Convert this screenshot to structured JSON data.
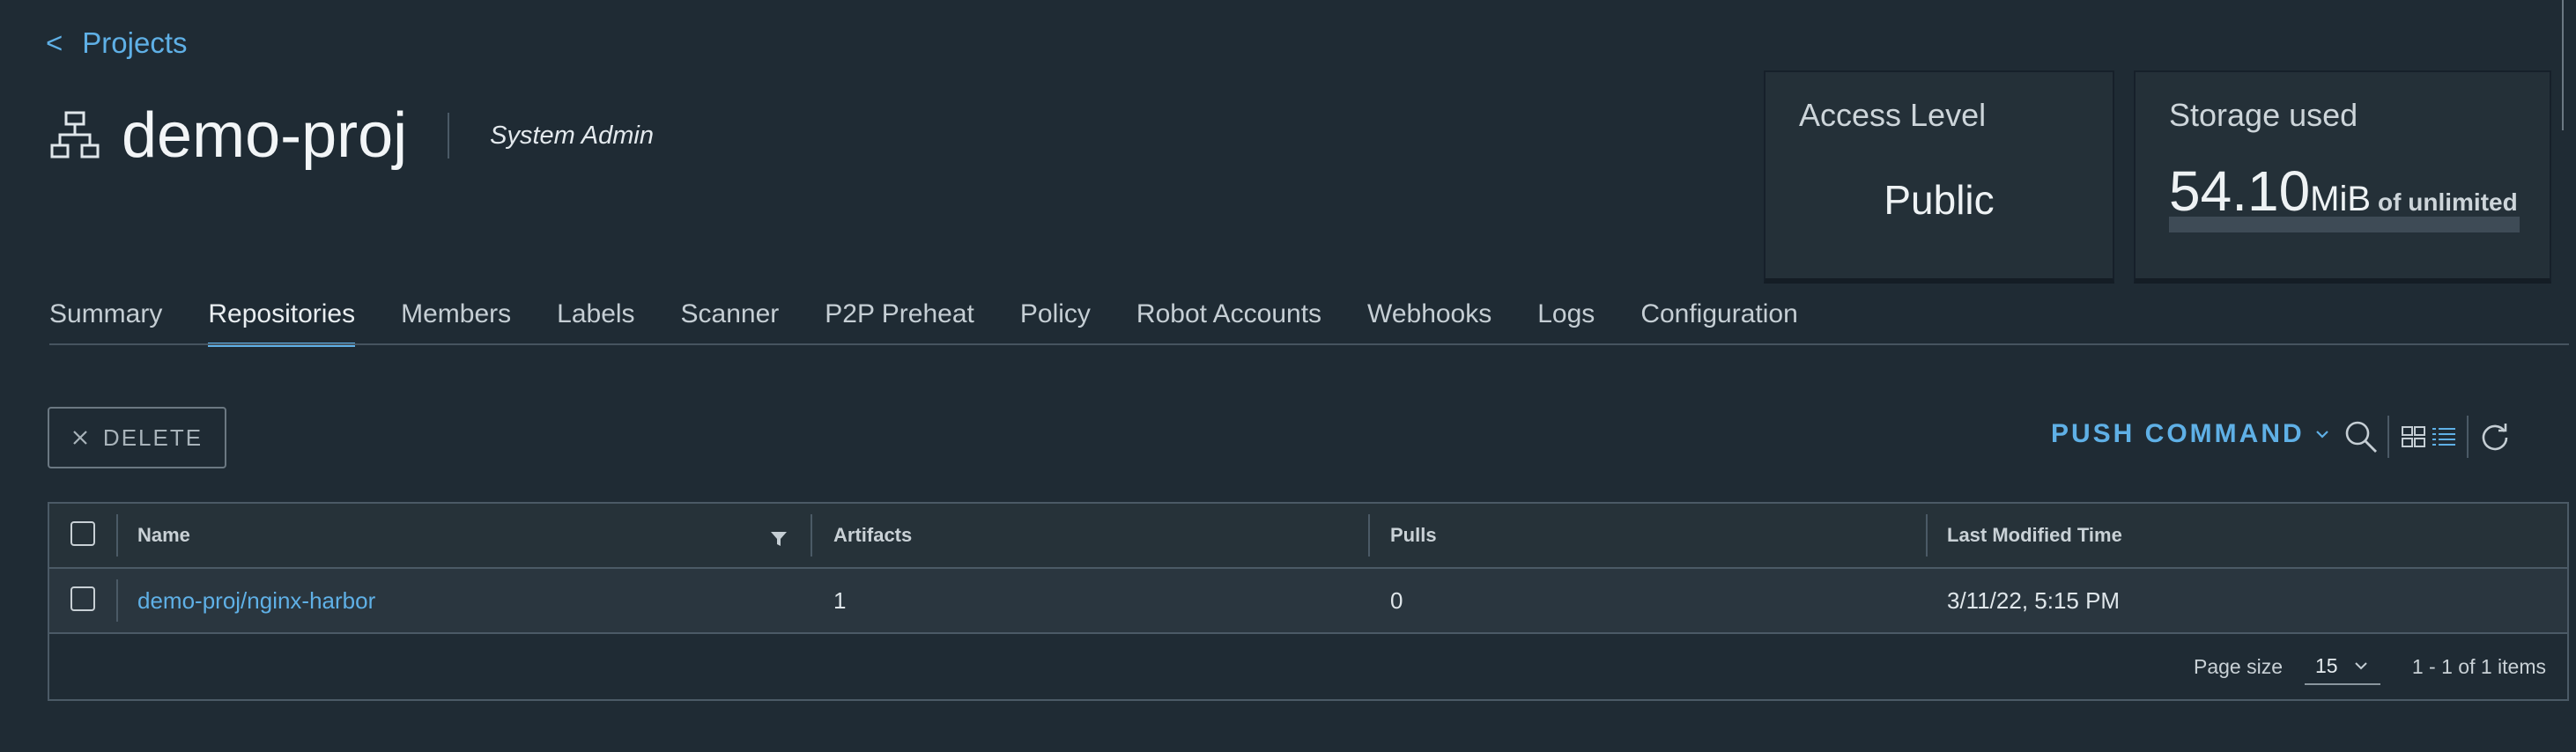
{
  "breadcrumb": {
    "chevron": "<",
    "label": "Projects"
  },
  "project": {
    "name": "demo-proj",
    "role": "System Admin",
    "icon": "project-hierarchy-icon"
  },
  "access_card": {
    "label": "Access Level",
    "value": "Public"
  },
  "storage_card": {
    "label": "Storage used",
    "amount": "54.10",
    "unit": "MiB",
    "quota_text": "of unlimited",
    "usage_fraction": 0
  },
  "tabs": [
    {
      "label": "Summary"
    },
    {
      "label": "Repositories",
      "active": true
    },
    {
      "label": "Members"
    },
    {
      "label": "Labels"
    },
    {
      "label": "Scanner"
    },
    {
      "label": "P2P Preheat"
    },
    {
      "label": "Policy"
    },
    {
      "label": "Robot Accounts"
    },
    {
      "label": "Webhooks"
    },
    {
      "label": "Logs"
    },
    {
      "label": "Configuration"
    }
  ],
  "toolbar": {
    "delete_label": "DELETE",
    "push_command_label": "PUSH COMMAND",
    "icons": [
      "close-icon",
      "chevron-down-icon",
      "search-icon",
      "card-view-icon",
      "list-view-icon",
      "refresh-icon"
    ]
  },
  "table": {
    "columns": [
      "Name",
      "Artifacts",
      "Pulls",
      "Last Modified Time"
    ],
    "rows": [
      {
        "name": "demo-proj/nginx-harbor",
        "artifacts": "1",
        "pulls": "0",
        "modified": "3/11/22, 5:15 PM"
      }
    ],
    "footer": {
      "page_size_label": "Page size",
      "page_size": "15",
      "items_text": "1 - 1 of 1 items"
    }
  },
  "colors": {
    "background": "#1f2b34",
    "accent": "#5fb0e6",
    "card": "#243038",
    "text": "#e5ebef"
  }
}
